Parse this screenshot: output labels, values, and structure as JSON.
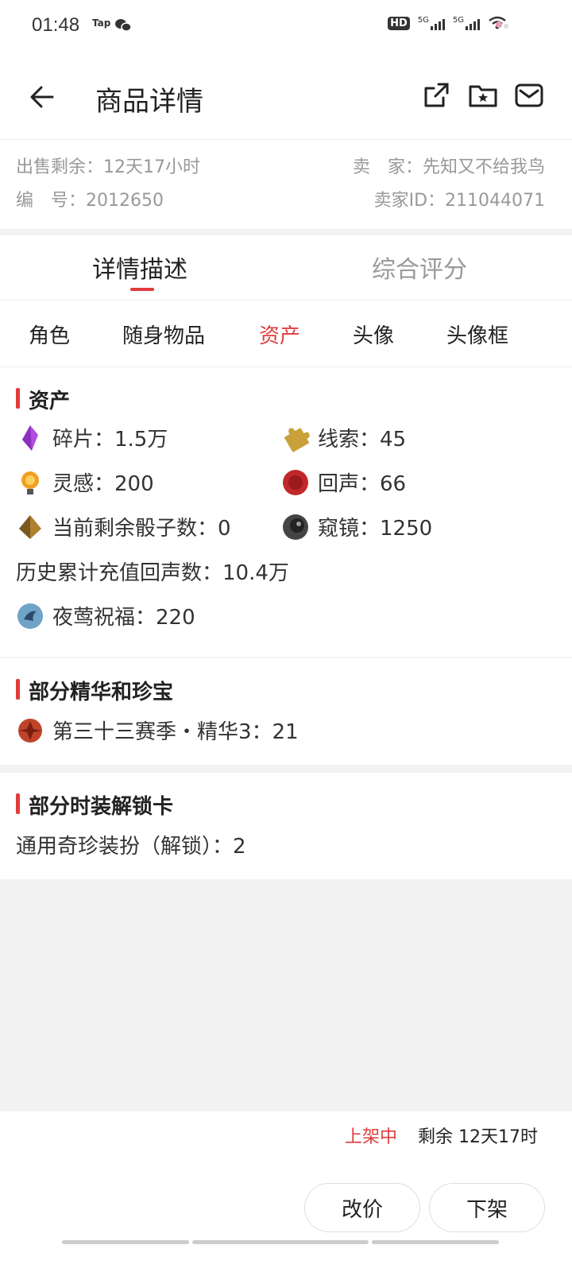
{
  "status_bar": {
    "time": "01:48",
    "app_label": "Tap",
    "net1": "5G",
    "net2": "5G",
    "hd": "HD"
  },
  "header": {
    "title": "商品详情"
  },
  "meta": {
    "sale_remaining": "出售剩余：12天17小时",
    "seller": "卖　家：先知又不给我鸟",
    "number": "编　号：2012650",
    "seller_id": "卖家ID：211044071"
  },
  "tabs": [
    {
      "label": "详情描述",
      "active": true
    },
    {
      "label": "综合评分",
      "active": false
    }
  ],
  "subtabs": [
    {
      "label": "角色",
      "active": false
    },
    {
      "label": "随身物品",
      "active": false
    },
    {
      "label": "资产",
      "active": true
    },
    {
      "label": "头像",
      "active": false
    },
    {
      "label": "头像框",
      "active": false
    }
  ],
  "assets": {
    "heading": "资产",
    "items": [
      {
        "label": "碎片：1.5万",
        "icon": "crystal-icon",
        "color": "#b24de0"
      },
      {
        "label": "线索：45",
        "icon": "puzzle-icon",
        "color": "#c9a03a"
      },
      {
        "label": "灵感：200",
        "icon": "bulb-icon",
        "color": "#f0a020"
      },
      {
        "label": "回声：66",
        "icon": "seal-icon",
        "color": "#c0282c"
      },
      {
        "label": "当前剩余骰子数：0",
        "icon": "dice-icon",
        "color": "#b08030"
      },
      {
        "label": "窥镜：1250",
        "icon": "lens-icon",
        "color": "#444444"
      },
      {
        "label": "历史累计充值回声数：10.4万"
      },
      {
        "label": "夜莺祝福：220",
        "icon": "nightingale-icon",
        "color": "#6fa3c8"
      }
    ]
  },
  "essence": {
    "heading": "部分精华和珍宝",
    "items": [
      {
        "label": "第三十三赛季・精华3：21",
        "icon": "essence-icon",
        "color": "#c0442a"
      }
    ]
  },
  "unlock_cards": {
    "heading": "部分时装解锁卡",
    "items": [
      {
        "label": "通用奇珍装扮（解锁）：2"
      }
    ]
  },
  "bottom": {
    "status": "上架中",
    "remaining": "剩余 12天17时",
    "change_price": "改价",
    "delist": "下架"
  },
  "colors": {
    "accent": "#e03c3c",
    "muted": "#999999"
  }
}
